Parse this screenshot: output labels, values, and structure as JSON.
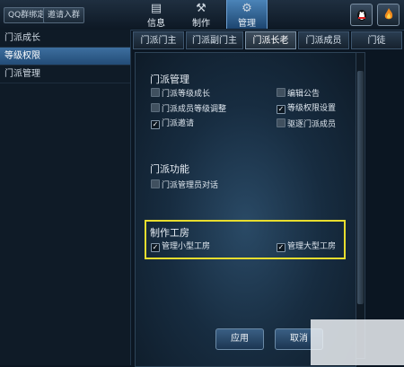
{
  "topbar": {
    "qq_group_label": "QQ群绑定",
    "invite_label": "邀请入群",
    "tabs": [
      {
        "label": "信息",
        "icon": "info-icon"
      },
      {
        "label": "制作",
        "icon": "hammer-icon"
      },
      {
        "label": "管理",
        "icon": "gears-icon"
      }
    ],
    "right_icons": [
      "penguin-icon",
      "fire-icon"
    ]
  },
  "sidebar": {
    "items": [
      {
        "label": "门派成长",
        "active": false
      },
      {
        "label": "等级权限",
        "active": true
      },
      {
        "label": "门派管理",
        "active": false
      }
    ]
  },
  "subtabs": [
    {
      "label": "门派门主",
      "active": false
    },
    {
      "label": "门派副门主",
      "active": false
    },
    {
      "label": "门派长老",
      "active": true
    },
    {
      "label": "门派成员",
      "active": false
    },
    {
      "label": "门徒",
      "active": false
    }
  ],
  "sections": {
    "management": {
      "title": "门派管理",
      "options": [
        {
          "label": "门派等级成长",
          "checked": false
        },
        {
          "label": "编辑公告",
          "checked": false
        },
        {
          "label": "门派成员等级调整",
          "checked": false
        },
        {
          "label": "等级权限设置",
          "checked": true
        },
        {
          "label": "门派邀请",
          "checked": true
        },
        {
          "label": "驱逐门派成员",
          "checked": false
        }
      ]
    },
    "function": {
      "title": "门派功能",
      "options": [
        {
          "label": "门派管理员对话",
          "checked": false
        }
      ]
    },
    "workshop": {
      "title": "制作工房",
      "options": [
        {
          "label": "管理小型工房",
          "checked": true
        },
        {
          "label": "管理大型工房",
          "checked": true
        }
      ]
    }
  },
  "buttons": {
    "apply": "应用",
    "cancel": "取消"
  },
  "colors": {
    "highlight": "#e8dd2e",
    "active_tab": "#3d6f9f"
  }
}
